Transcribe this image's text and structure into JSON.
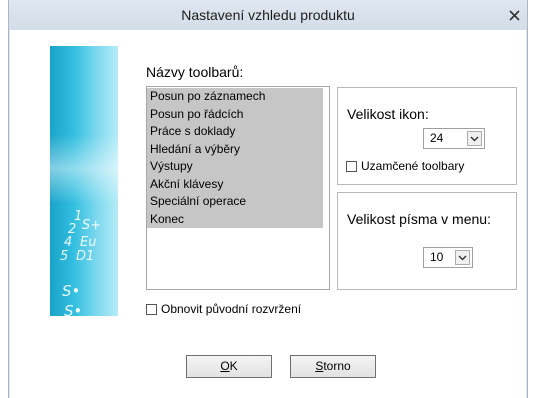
{
  "window": {
    "title": "Nastavení vzhledu produktu"
  },
  "side_image": {
    "glyphs": [
      "1",
      "2",
      "S+",
      "4",
      "Eu",
      "5",
      "D1",
      "S•",
      "S•"
    ]
  },
  "toolbars": {
    "label": "Názvy toolbarů:",
    "items": [
      "Posun po záznamech",
      "Posun po řádcích",
      "Práce s doklady",
      "Hledání a výběry",
      "Výstupy",
      "Akční klávesy",
      "Speciální operace",
      "Konec"
    ]
  },
  "icon_size": {
    "label": "Velikost ikon:",
    "value": "24"
  },
  "locked_toolbars": {
    "label": "Uzamčené toolbary"
  },
  "menu_font": {
    "label": "Velikost písma v menu:",
    "value": "10"
  },
  "restore_layout": {
    "label": "Obnovit původní rozvržení"
  },
  "buttons": {
    "ok": {
      "mnemonic": "O",
      "rest": "K"
    },
    "cancel": {
      "mnemonic": "S",
      "rest": "torno"
    }
  },
  "colors": {
    "list_selection": "#c6c6c6",
    "dialog_frame": "#dce3ea"
  }
}
